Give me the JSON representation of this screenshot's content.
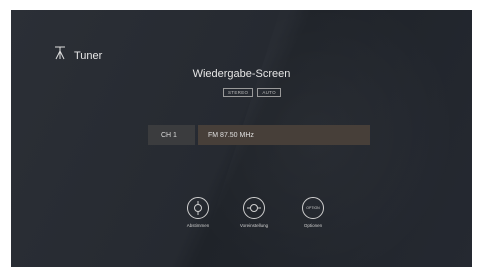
{
  "source": {
    "title": "Tuner",
    "icon": "antenna-icon"
  },
  "playback": {
    "title": "Wiedergabe-Screen",
    "badges": [
      "STEREO",
      "AUTO"
    ],
    "channel": "CH 1",
    "frequency": "FM 87.50 MHz"
  },
  "controls": [
    {
      "label": "Abstimmen",
      "icon": "tune-icon"
    },
    {
      "label": "Voreinstellung",
      "icon": "preset-icon"
    },
    {
      "label": "Optionen",
      "icon": "option-icon",
      "icon_text": "OPTION"
    }
  ]
}
